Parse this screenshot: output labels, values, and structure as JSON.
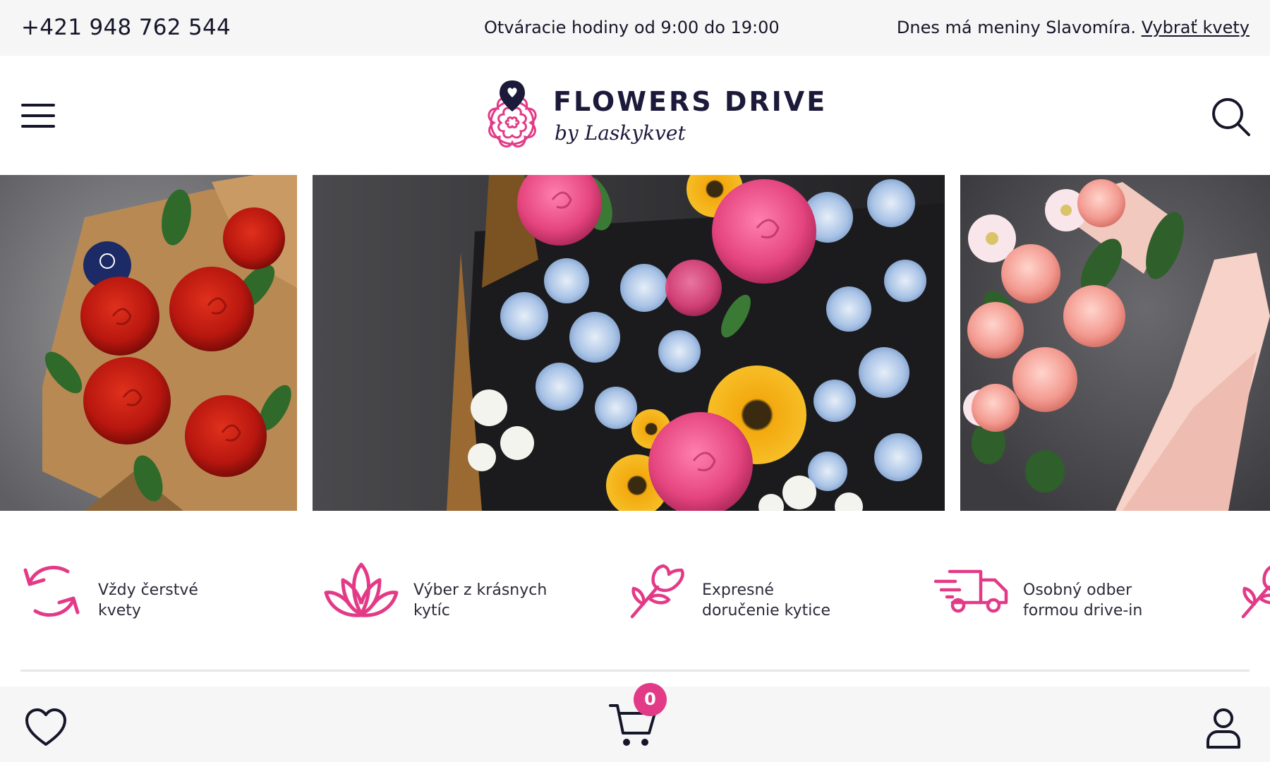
{
  "topbar": {
    "phone": "+421 948 762 544",
    "hours": "Otváracie hodiny od 9:00 do 19:00",
    "nameday_text": "Dnes má meniny Slavomíra.",
    "nameday_link": "Vybrať kvety"
  },
  "header": {
    "logo_title": "FLOWERS DRIVE",
    "logo_sub": "by Laskykvet",
    "menu_icon": "hamburger-icon",
    "search_icon": "search-icon"
  },
  "slider": {
    "slides": [
      {
        "subject": "red roses bouquet",
        "icon": "slide-image"
      },
      {
        "subject": "mixed bouquet",
        "icon": "slide-image"
      },
      {
        "subject": "pink carnations bouquet",
        "icon": "slide-image"
      }
    ]
  },
  "features": [
    {
      "line1": "Vždy čerstvé",
      "line2": "kvety",
      "icon": "refresh-icon"
    },
    {
      "line1": "Výber z krásnych",
      "line2": "kytíc",
      "icon": "lotus-icon"
    },
    {
      "line1": "Expresné",
      "line2": "doručenie kytice",
      "icon": "rose-icon"
    },
    {
      "line1": "Osobný odber",
      "line2": "formou drive-in",
      "icon": "delivery-truck-icon"
    }
  ],
  "bottombar": {
    "cart_count": "0",
    "wishlist_icon": "heart-icon",
    "cart_icon": "cart-icon",
    "account_icon": "user-icon"
  },
  "colors": {
    "accent": "#e33a87",
    "text": "#16162a",
    "bar_bg": "#f6f6f6"
  }
}
